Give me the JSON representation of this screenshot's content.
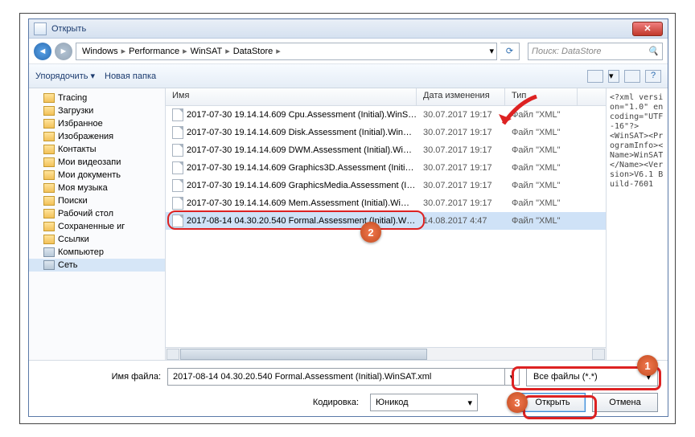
{
  "title": "Открыть",
  "close_glyph": "✕",
  "nav": {
    "back": "◄",
    "fwd": "►"
  },
  "breadcrumb": [
    "Windows",
    "Performance",
    "WinSAT",
    "DataStore"
  ],
  "breadcrumb_drop": "▾",
  "refresh_glyph": "⟳",
  "search": {
    "placeholder": "Поиск: DataStore",
    "icon": "🔍"
  },
  "toolbar": {
    "organize": "Упорядочить",
    "organize_drop": "▾",
    "newfolder": "Новая папка",
    "view_drop": "▾",
    "help": "?"
  },
  "tree": [
    {
      "label": "Tracing",
      "ico": "folder"
    },
    {
      "label": "Загрузки",
      "ico": "folder"
    },
    {
      "label": "Избранное",
      "ico": "folder"
    },
    {
      "label": "Изображения",
      "ico": "folder"
    },
    {
      "label": "Контакты",
      "ico": "folder"
    },
    {
      "label": "Мои видеозапи",
      "ico": "folder"
    },
    {
      "label": "Мои документь",
      "ico": "folder"
    },
    {
      "label": "Моя музыка",
      "ico": "folder"
    },
    {
      "label": "Поиски",
      "ico": "folder"
    },
    {
      "label": "Рабочий стол",
      "ico": "folder"
    },
    {
      "label": "Сохраненные иг",
      "ico": "folder"
    },
    {
      "label": "Ссылки",
      "ico": "folder"
    },
    {
      "label": "Компьютер",
      "ico": "drive"
    },
    {
      "label": "Сеть",
      "ico": "drive",
      "sel": true
    }
  ],
  "columns": {
    "name": "Имя",
    "date": "Дата изменения",
    "type": "Тип"
  },
  "files": [
    {
      "name": "2017-07-30 19.14.14.609 Cpu.Assessment (Initial).WinS…",
      "date": "30.07.2017 19:17",
      "type": "Файл \"XML\""
    },
    {
      "name": "2017-07-30 19.14.14.609 Disk.Assessment (Initial).Win…",
      "date": "30.07.2017 19:17",
      "type": "Файл \"XML\""
    },
    {
      "name": "2017-07-30 19.14.14.609 DWM.Assessment (Initial).Wi…",
      "date": "30.07.2017 19:17",
      "type": "Файл \"XML\""
    },
    {
      "name": "2017-07-30 19.14.14.609 Graphics3D.Assessment (Initi…",
      "date": "30.07.2017 19:17",
      "type": "Файл \"XML\""
    },
    {
      "name": "2017-07-30 19.14.14.609 GraphicsMedia.Assessment (I…",
      "date": "30.07.2017 19:17",
      "type": "Файл \"XML\""
    },
    {
      "name": "2017-07-30 19.14.14.609 Mem.Assessment (Initial).Wi…",
      "date": "30.07.2017 19:17",
      "type": "Файл \"XML\""
    },
    {
      "name": "2017-08-14 04.30.20.540 Formal.Assessment (Initial).W…",
      "date": "14.08.2017 4:47",
      "type": "Файл \"XML\"",
      "selected": true
    }
  ],
  "preview_text": "<?xml version=\"1.0\" encoding=\"UTF-16\"?>\n<WinSAT><ProgramInfo><Name>WinSAT</Name><Version>V6.1 Build-7601",
  "bottom": {
    "filename_label": "Имя файла:",
    "filename_value": "2017-08-14 04.30.20.540 Formal.Assessment (Initial).WinSAT.xml",
    "filter_value": "Все файлы (*.*)",
    "encoding_label": "Кодировка:",
    "encoding_value": "Юникод",
    "open": "Открыть",
    "cancel": "Отмена",
    "drop": "▾"
  },
  "callouts": {
    "one": "1",
    "two": "2",
    "three": "3"
  }
}
